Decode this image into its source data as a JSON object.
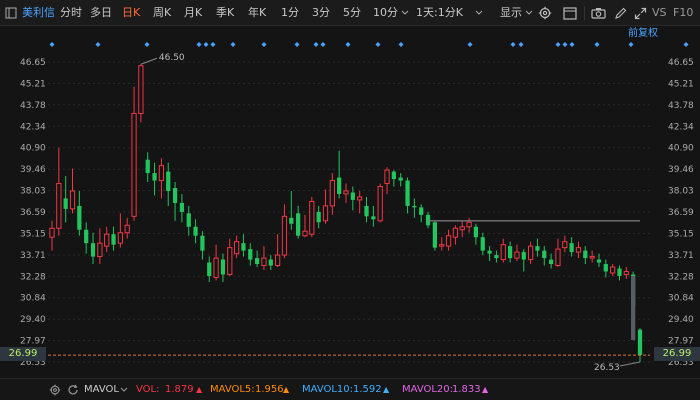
{
  "toolbar": {
    "stock_name": "美利信",
    "tabs": [
      "分时",
      "多日",
      "日K",
      "周K",
      "月K",
      "季K",
      "年K",
      "1分",
      "3分",
      "5分",
      "10分"
    ],
    "active_tab": "日K",
    "dropdown": "1天:1分K",
    "display_label": "显示",
    "vs_label": "VS",
    "f10_label": "F10"
  },
  "adjust_label": "前复权",
  "price_axis": {
    "ticks": [
      "46.65",
      "45.21",
      "43.78",
      "42.34",
      "40.90",
      "39.46",
      "38.03",
      "36.59",
      "35.15",
      "33.71",
      "32.28",
      "30.84",
      "29.40",
      "27.97",
      "26.53"
    ],
    "current_price": "26.99",
    "high_label": "46.50",
    "low_label": "26.53"
  },
  "colors": {
    "up": "#f23645",
    "down": "#22c55e",
    "background": "#141414",
    "grid": "#2a2a2a",
    "accent": "#ff6a3d"
  },
  "chart_data": {
    "type": "candlestick",
    "ylim": [
      26.53,
      46.65
    ],
    "high_value": 46.5,
    "low_value": 26.53,
    "current_price": 26.99,
    "resistance_line": 36.0,
    "candles": [
      {
        "o": 34.9,
        "c": 35.5,
        "h": 36.0,
        "l": 34.0
      },
      {
        "o": 35.5,
        "c": 38.5,
        "h": 40.9,
        "l": 35.0
      },
      {
        "o": 37.5,
        "c": 36.8,
        "h": 39.0,
        "l": 35.9
      },
      {
        "o": 36.8,
        "c": 38.0,
        "h": 39.5,
        "l": 36.5
      },
      {
        "o": 37.0,
        "c": 35.4,
        "h": 38.0,
        "l": 35.0
      },
      {
        "o": 35.4,
        "c": 34.5,
        "h": 35.9,
        "l": 33.8
      },
      {
        "o": 34.5,
        "c": 33.6,
        "h": 35.2,
        "l": 33.1
      },
      {
        "o": 33.6,
        "c": 34.5,
        "h": 35.5,
        "l": 33.1
      },
      {
        "o": 34.3,
        "c": 35.1,
        "h": 35.6,
        "l": 33.9
      },
      {
        "o": 35.1,
        "c": 34.4,
        "h": 35.6,
        "l": 34.0
      },
      {
        "o": 34.5,
        "c": 35.2,
        "h": 36.5,
        "l": 34.2
      },
      {
        "o": 35.2,
        "c": 35.7,
        "h": 36.2,
        "l": 34.8
      },
      {
        "o": 36.3,
        "c": 43.2,
        "h": 45.0,
        "l": 36.0
      },
      {
        "o": 43.2,
        "c": 46.4,
        "h": 46.5,
        "l": 42.6
      },
      {
        "o": 40.1,
        "c": 39.2,
        "h": 40.6,
        "l": 38.6
      },
      {
        "o": 39.2,
        "c": 38.7,
        "h": 39.9,
        "l": 37.7
      },
      {
        "o": 38.7,
        "c": 39.7,
        "h": 40.2,
        "l": 37.5
      },
      {
        "o": 39.3,
        "c": 38.0,
        "h": 39.9,
        "l": 37.0
      },
      {
        "o": 38.2,
        "c": 37.2,
        "h": 38.6,
        "l": 36.0
      },
      {
        "o": 37.2,
        "c": 36.6,
        "h": 37.8,
        "l": 35.9
      },
      {
        "o": 36.5,
        "c": 35.6,
        "h": 37.0,
        "l": 35.0
      },
      {
        "o": 35.6,
        "c": 35.0,
        "h": 36.1,
        "l": 34.5
      },
      {
        "o": 35.0,
        "c": 34.0,
        "h": 35.3,
        "l": 33.4
      },
      {
        "o": 33.2,
        "c": 32.3,
        "h": 33.6,
        "l": 31.9
      },
      {
        "o": 32.2,
        "c": 33.5,
        "h": 34.4,
        "l": 32.0
      },
      {
        "o": 33.4,
        "c": 32.4,
        "h": 33.8,
        "l": 31.9
      },
      {
        "o": 32.4,
        "c": 34.2,
        "h": 34.8,
        "l": 32.3
      },
      {
        "o": 33.8,
        "c": 34.6,
        "h": 35.0,
        "l": 33.5
      },
      {
        "o": 34.5,
        "c": 34.0,
        "h": 35.1,
        "l": 33.6
      },
      {
        "o": 34.1,
        "c": 33.4,
        "h": 34.5,
        "l": 33.0
      },
      {
        "o": 33.5,
        "c": 33.1,
        "h": 34.0,
        "l": 32.9
      },
      {
        "o": 33.0,
        "c": 33.5,
        "h": 34.3,
        "l": 32.7
      },
      {
        "o": 33.4,
        "c": 33.0,
        "h": 33.7,
        "l": 32.7
      },
      {
        "o": 33.0,
        "c": 33.7,
        "h": 35.1,
        "l": 32.9
      },
      {
        "o": 33.7,
        "c": 36.3,
        "h": 37.1,
        "l": 33.5
      },
      {
        "o": 36.2,
        "c": 35.8,
        "h": 38.0,
        "l": 35.4
      },
      {
        "o": 36.5,
        "c": 35.0,
        "h": 37.0,
        "l": 34.8
      },
      {
        "o": 35.0,
        "c": 35.3,
        "h": 36.4,
        "l": 34.9
      },
      {
        "o": 35.1,
        "c": 37.3,
        "h": 37.6,
        "l": 34.9
      },
      {
        "o": 36.6,
        "c": 35.9,
        "h": 37.0,
        "l": 35.5
      },
      {
        "o": 36.0,
        "c": 37.0,
        "h": 38.1,
        "l": 35.8
      },
      {
        "o": 37.0,
        "c": 38.7,
        "h": 39.2,
        "l": 36.4
      },
      {
        "o": 38.9,
        "c": 37.8,
        "h": 40.7,
        "l": 37.5
      },
      {
        "o": 37.8,
        "c": 38.0,
        "h": 38.5,
        "l": 37.2
      },
      {
        "o": 37.9,
        "c": 37.4,
        "h": 38.3,
        "l": 36.7
      },
      {
        "o": 37.4,
        "c": 37.6,
        "h": 38.0,
        "l": 36.5
      },
      {
        "o": 37.0,
        "c": 36.3,
        "h": 37.6,
        "l": 35.9
      },
      {
        "o": 36.3,
        "c": 36.1,
        "h": 37.0,
        "l": 35.6
      },
      {
        "o": 36.0,
        "c": 38.3,
        "h": 38.5,
        "l": 35.9
      },
      {
        "o": 38.5,
        "c": 39.4,
        "h": 39.6,
        "l": 37.8
      },
      {
        "o": 39.3,
        "c": 38.8,
        "h": 39.4,
        "l": 38.3
      },
      {
        "o": 38.9,
        "c": 38.7,
        "h": 39.2,
        "l": 38.3
      },
      {
        "o": 38.7,
        "c": 37.0,
        "h": 38.9,
        "l": 36.5
      },
      {
        "o": 37.0,
        "c": 36.9,
        "h": 37.5,
        "l": 36.2
      },
      {
        "o": 36.9,
        "c": 36.4,
        "h": 37.1,
        "l": 35.9
      },
      {
        "o": 36.4,
        "c": 35.7,
        "h": 36.6,
        "l": 35.5
      },
      {
        "o": 35.9,
        "c": 34.2,
        "h": 36.0,
        "l": 34.0
      },
      {
        "o": 34.3,
        "c": 34.4,
        "h": 34.9,
        "l": 34.0
      },
      {
        "o": 34.3,
        "c": 35.0,
        "h": 35.4,
        "l": 34.0
      },
      {
        "o": 34.9,
        "c": 35.5,
        "h": 35.7,
        "l": 34.4
      },
      {
        "o": 35.4,
        "c": 35.6,
        "h": 36.0,
        "l": 34.9
      },
      {
        "o": 35.6,
        "c": 35.9,
        "h": 36.2,
        "l": 35.2
      },
      {
        "o": 35.6,
        "c": 34.9,
        "h": 35.8,
        "l": 34.4
      },
      {
        "o": 34.9,
        "c": 34.0,
        "h": 35.2,
        "l": 33.7
      },
      {
        "o": 34.0,
        "c": 33.8,
        "h": 34.3,
        "l": 33.3
      },
      {
        "o": 33.7,
        "c": 33.5,
        "h": 34.0,
        "l": 33.2
      },
      {
        "o": 33.4,
        "c": 34.4,
        "h": 34.8,
        "l": 33.2
      },
      {
        "o": 34.3,
        "c": 33.5,
        "h": 34.6,
        "l": 33.2
      },
      {
        "o": 33.5,
        "c": 33.9,
        "h": 34.4,
        "l": 33.3
      },
      {
        "o": 33.9,
        "c": 33.4,
        "h": 34.1,
        "l": 32.6
      },
      {
        "o": 33.4,
        "c": 34.3,
        "h": 34.6,
        "l": 33.1
      },
      {
        "o": 34.3,
        "c": 34.0,
        "h": 34.8,
        "l": 33.6
      },
      {
        "o": 34.0,
        "c": 33.5,
        "h": 34.3,
        "l": 33.0
      },
      {
        "o": 33.4,
        "c": 33.1,
        "h": 33.8,
        "l": 32.8
      },
      {
        "o": 33.0,
        "c": 34.1,
        "h": 34.8,
        "l": 32.9
      },
      {
        "o": 34.2,
        "c": 34.6,
        "h": 35.0,
        "l": 33.9
      },
      {
        "o": 34.5,
        "c": 33.9,
        "h": 34.9,
        "l": 33.6
      },
      {
        "o": 33.9,
        "c": 34.2,
        "h": 34.6,
        "l": 33.5
      },
      {
        "o": 34.0,
        "c": 33.5,
        "h": 34.3,
        "l": 33.1
      },
      {
        "o": 33.5,
        "c": 33.6,
        "h": 34.0,
        "l": 33.2
      },
      {
        "o": 33.4,
        "c": 33.2,
        "h": 33.8,
        "l": 32.9
      },
      {
        "o": 33.1,
        "c": 32.6,
        "h": 33.4,
        "l": 32.2
      },
      {
        "o": 32.5,
        "c": 32.9,
        "h": 33.1,
        "l": 32.3
      },
      {
        "o": 32.8,
        "c": 32.3,
        "h": 33.0,
        "l": 32.0
      },
      {
        "o": 32.4,
        "c": 32.6,
        "h": 32.9,
        "l": 32.1
      },
      {
        "o": 32.4,
        "c": 30.3,
        "h": 32.6,
        "l": 30.1
      },
      {
        "o": 28.7,
        "c": 27.0,
        "h": 28.8,
        "l": 26.53
      }
    ]
  },
  "volume_bar": {
    "indicator": "MAVOL",
    "items": [
      {
        "label": "VOL:",
        "value": "1.879",
        "color": "#f23645"
      },
      {
        "label": "MAVOL5:",
        "value": "1.956",
        "color": "#ff8a00"
      },
      {
        "label": "MAVOL10:",
        "value": "1.592",
        "color": "#3fb0ff"
      },
      {
        "label": "MAVOL20:",
        "value": "1.833",
        "color": "#e066e6"
      }
    ]
  }
}
